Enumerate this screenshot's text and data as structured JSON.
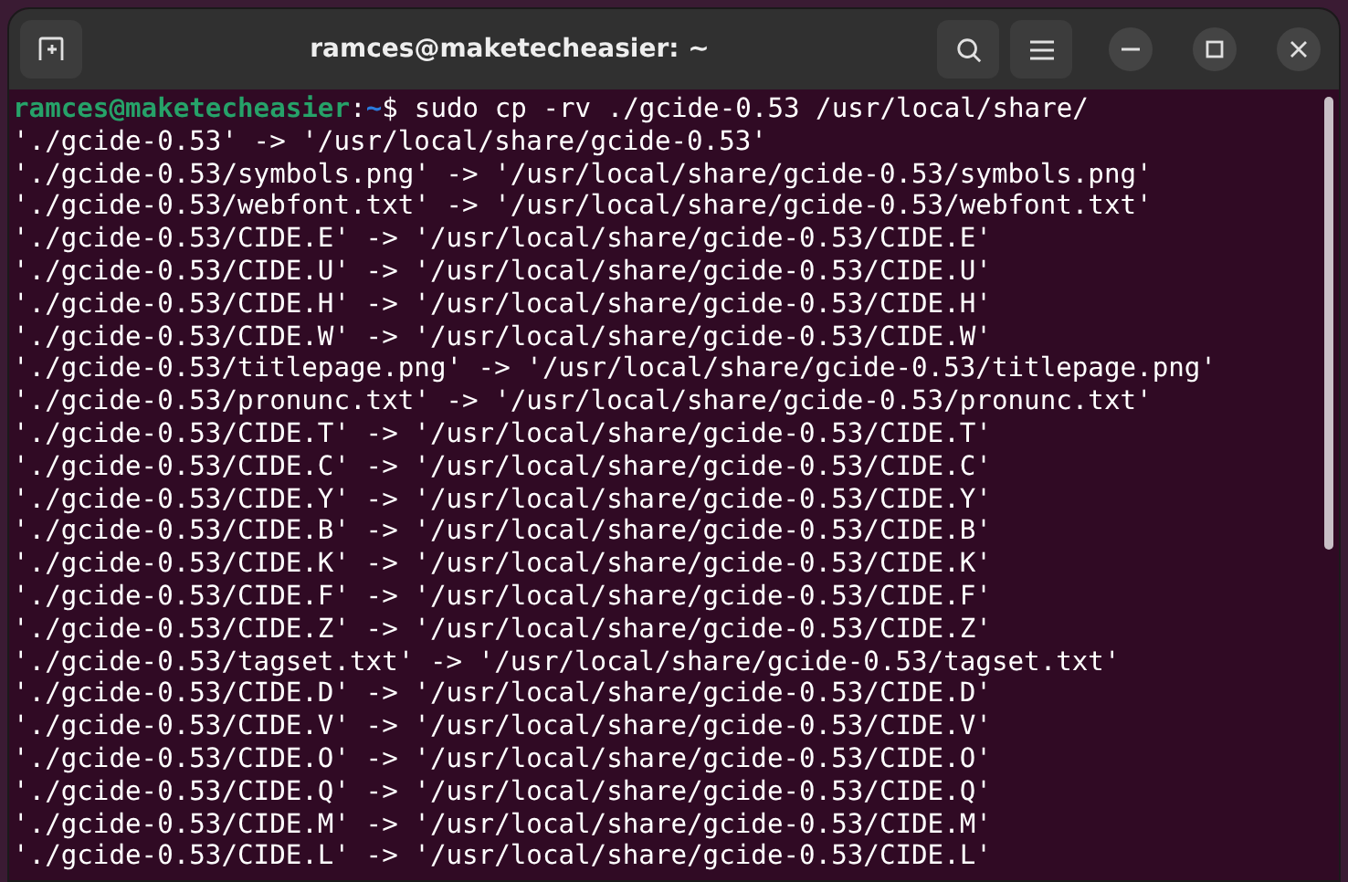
{
  "window": {
    "title": "ramces@maketecheasier: ~"
  },
  "prompt": {
    "user_host": "ramces@maketecheasier",
    "separator": ":",
    "path": "~",
    "symbol": "$",
    "command": "sudo cp -rv ./gcide-0.53 /usr/local/share/"
  },
  "output": [
    "'./gcide-0.53' -> '/usr/local/share/gcide-0.53'",
    "'./gcide-0.53/symbols.png' -> '/usr/local/share/gcide-0.53/symbols.png'",
    "'./gcide-0.53/webfont.txt' -> '/usr/local/share/gcide-0.53/webfont.txt'",
    "'./gcide-0.53/CIDE.E' -> '/usr/local/share/gcide-0.53/CIDE.E'",
    "'./gcide-0.53/CIDE.U' -> '/usr/local/share/gcide-0.53/CIDE.U'",
    "'./gcide-0.53/CIDE.H' -> '/usr/local/share/gcide-0.53/CIDE.H'",
    "'./gcide-0.53/CIDE.W' -> '/usr/local/share/gcide-0.53/CIDE.W'",
    "'./gcide-0.53/titlepage.png' -> '/usr/local/share/gcide-0.53/titlepage.png'",
    "'./gcide-0.53/pronunc.txt' -> '/usr/local/share/gcide-0.53/pronunc.txt'",
    "'./gcide-0.53/CIDE.T' -> '/usr/local/share/gcide-0.53/CIDE.T'",
    "'./gcide-0.53/CIDE.C' -> '/usr/local/share/gcide-0.53/CIDE.C'",
    "'./gcide-0.53/CIDE.Y' -> '/usr/local/share/gcide-0.53/CIDE.Y'",
    "'./gcide-0.53/CIDE.B' -> '/usr/local/share/gcide-0.53/CIDE.B'",
    "'./gcide-0.53/CIDE.K' -> '/usr/local/share/gcide-0.53/CIDE.K'",
    "'./gcide-0.53/CIDE.F' -> '/usr/local/share/gcide-0.53/CIDE.F'",
    "'./gcide-0.53/CIDE.Z' -> '/usr/local/share/gcide-0.53/CIDE.Z'",
    "'./gcide-0.53/tagset.txt' -> '/usr/local/share/gcide-0.53/tagset.txt'",
    "'./gcide-0.53/CIDE.D' -> '/usr/local/share/gcide-0.53/CIDE.D'",
    "'./gcide-0.53/CIDE.V' -> '/usr/local/share/gcide-0.53/CIDE.V'",
    "'./gcide-0.53/CIDE.O' -> '/usr/local/share/gcide-0.53/CIDE.O'",
    "'./gcide-0.53/CIDE.Q' -> '/usr/local/share/gcide-0.53/CIDE.Q'",
    "'./gcide-0.53/CIDE.M' -> '/usr/local/share/gcide-0.53/CIDE.M'",
    "'./gcide-0.53/CIDE.L' -> '/usr/local/share/gcide-0.53/CIDE.L'"
  ]
}
